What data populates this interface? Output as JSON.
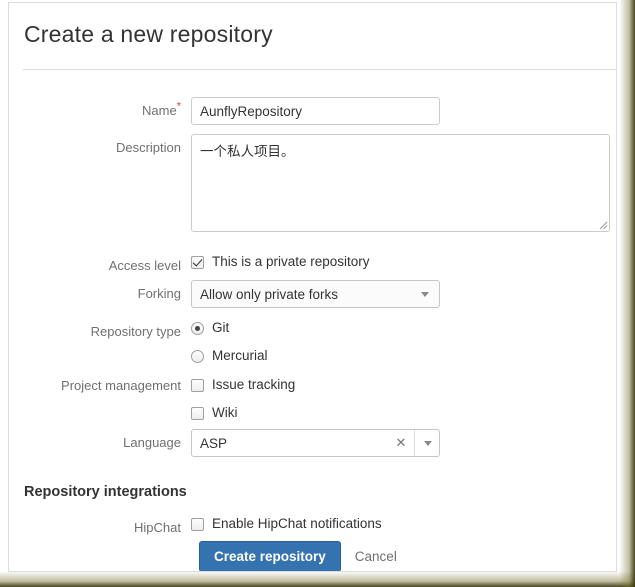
{
  "page": {
    "title": "Create a new repository"
  },
  "form": {
    "name": {
      "label": "Name",
      "required_marker": "*",
      "value": "AunflyRepository",
      "placeholder": ""
    },
    "description": {
      "label": "Description",
      "value": "一个私人项目。",
      "placeholder": ""
    },
    "access_level": {
      "label": "Access level",
      "checkbox_label": "This is a private repository",
      "checked": true
    },
    "forking": {
      "label": "Forking",
      "selected": "Allow only private forks",
      "options": [
        "Allow only private forks"
      ]
    },
    "repository_type": {
      "label": "Repository type",
      "options": [
        {
          "label": "Git",
          "selected": true
        },
        {
          "label": "Mercurial",
          "selected": false
        }
      ]
    },
    "project_management": {
      "label": "Project management",
      "options": [
        {
          "label": "Issue tracking",
          "checked": false
        },
        {
          "label": "Wiki",
          "checked": false
        }
      ]
    },
    "language": {
      "label": "Language",
      "value": "ASP",
      "clear_icon": "close-icon",
      "dropdown_icon": "chevron-down-icon"
    }
  },
  "integrations": {
    "heading": "Repository integrations",
    "hipchat": {
      "label": "HipChat",
      "checkbox_label": "Enable HipChat notifications",
      "checked": false
    }
  },
  "actions": {
    "submit_label": "Create repository",
    "cancel_label": "Cancel"
  },
  "colors": {
    "primary_button": "#3572b0",
    "required_asterisk": "#d04437",
    "label_text": "#707070",
    "body_text": "#333333"
  }
}
